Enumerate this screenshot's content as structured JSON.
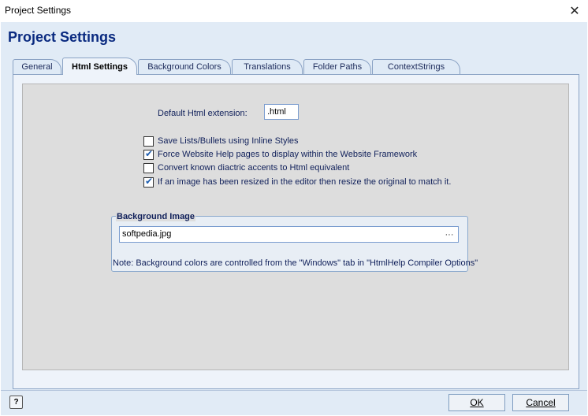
{
  "window": {
    "title": "Project Settings",
    "close_glyph": "✕"
  },
  "heading": "Project Settings",
  "tabs": [
    {
      "label": "General",
      "active": false
    },
    {
      "label": "Html Settings",
      "active": true
    },
    {
      "label": "Background Colors",
      "active": false
    },
    {
      "label": "Translations",
      "active": false
    },
    {
      "label": "Folder Paths",
      "active": false
    },
    {
      "label": "ContextStrings",
      "active": false
    }
  ],
  "html_settings": {
    "default_ext_label": "Default Html extension:",
    "default_ext_value": ".html",
    "options": [
      {
        "label": "Save Lists/Bullets using Inline Styles",
        "checked": false
      },
      {
        "label": "Force Website Help pages to display within the Website Framework",
        "checked": true
      },
      {
        "label": "Convert known diactric accents to Html equivalent",
        "checked": false
      },
      {
        "label": "If an image has been resized in the editor then resize the original to match it.",
        "checked": true
      }
    ],
    "background_image": {
      "title": "Background Image",
      "value": "softpedia.jpg",
      "browse_label": "···"
    },
    "note": "Note: Background colors are controlled from the \"Windows\" tab in \"HtmlHelp Compiler Options\""
  },
  "footer": {
    "help_label": "?",
    "ok_label": "OK",
    "cancel_label": "Cancel"
  },
  "colors": {
    "heading": "#0a2a80",
    "accent_check": "#1f5fb0"
  }
}
